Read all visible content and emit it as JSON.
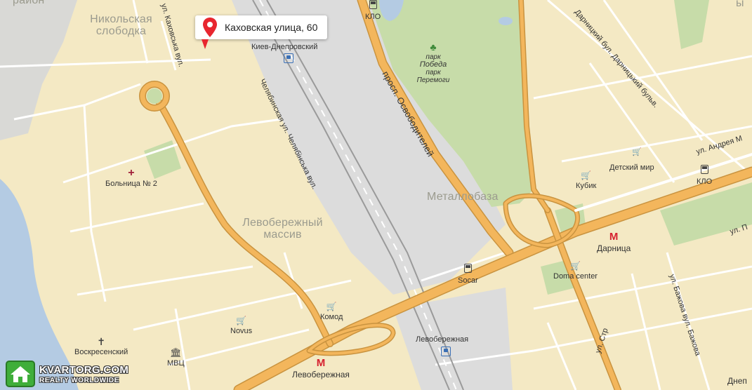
{
  "marker": {
    "address": "Каховская улица, 60"
  },
  "districts": {
    "corner_top_left": "район",
    "nikolskaya_line1": "Никольская",
    "nikolskaya_line2": "слободка",
    "levoberezhny_line1": "Левобережный",
    "levoberezhny_line2": "массив",
    "metallobaza": "Металлобаза"
  },
  "streets": {
    "kakhovska": "ул. Каховська вул.",
    "chelyabinskaya": "Челябинская ул. Челябінська вул.",
    "osvoboditeley": "просп. Освободителей",
    "darnitsky": "Дарницкий бул. Дарницький бульв.",
    "andreya": "ул. Андрея М",
    "bazhova": "ул. Бажова вул. Бажова",
    "str": "ул. Стр",
    "ul_p": "ул. П",
    "corner_right": "ы"
  },
  "park": {
    "line1": "парк",
    "line2": "Победа",
    "line3": "парк",
    "line4": "Перемоги"
  },
  "pois": {
    "klo_top": "КЛО",
    "kiev_dneprovsky": "Киев-Днепровский",
    "hospital": "Больница № 2",
    "detsky_mir": "Детский мир",
    "kubik": "Кубик",
    "klo_right": "КЛО",
    "darnitsa": "Дарница",
    "socar": "Socar",
    "doma_center": "Doma center",
    "komod": "Комод",
    "novus": "Novus",
    "voskresensky": "Воскресенский",
    "mvc": "МВЦ",
    "levoberezhnaya_rail": "Левобережная",
    "levoberezhnaya_metro": "Левобережная",
    "dnepr_corner": "Днеп"
  },
  "watermark": {
    "title": "KVARTORG.COM",
    "subtitle": "REALTY WORLDWIDE"
  },
  "colors": {
    "land": "#f4e9c4",
    "water": "#b4cbe3",
    "park": "#c7dca9",
    "industrial": "#dcdcdc",
    "major_road": "#f3b65c",
    "minor_road": "#ffffff",
    "marker": "#e8262f",
    "metro": "#d6212f"
  }
}
